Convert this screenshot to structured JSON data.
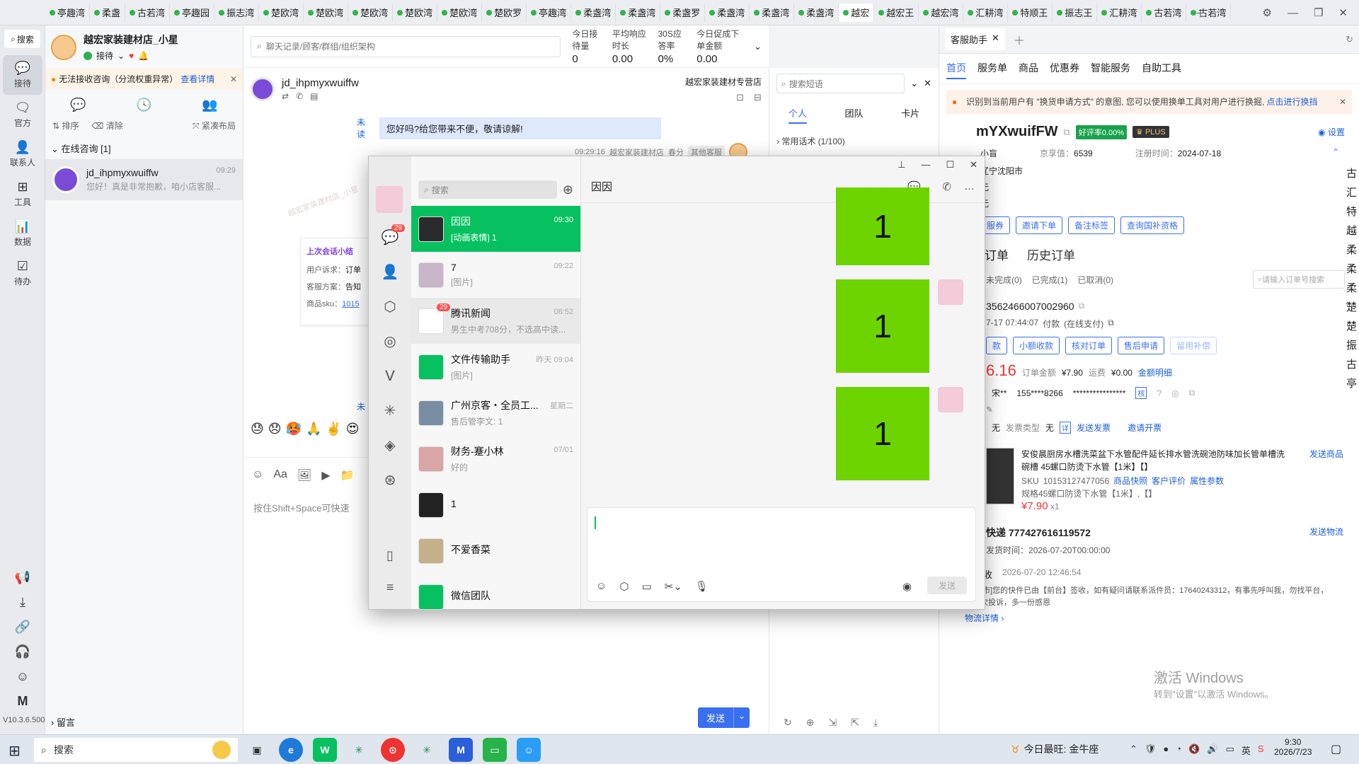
{
  "tabs": [
    "亭趣湾",
    "柔盏",
    "古若湾",
    "亭趣园",
    "振志湾",
    "楚欧湾",
    "楚欧湾",
    "楚欧湾",
    "楚欧湾",
    "楚欧湾",
    "楚欧罗",
    "亭趣湾",
    "柔盏湾",
    "柔盏湾",
    "柔盏罗",
    "柔盏湾",
    "柔盏湾",
    "柔盏湾",
    "越宏",
    "越宏王",
    "越宏湾",
    "汇耕湾",
    "特顺王",
    "振志王",
    "汇耕湾",
    "古若湾",
    "古若湾"
  ],
  "active_tab": 18,
  "leftnav": {
    "search": "搜索",
    "items": [
      {
        "label": "接待",
        "icon": "chat-icon"
      },
      {
        "label": "官方",
        "icon": "message-icon"
      },
      {
        "label": "联系人",
        "icon": "user-icon"
      },
      {
        "label": "工具",
        "icon": "grid-icon"
      },
      {
        "label": "数据",
        "icon": "chart-icon"
      },
      {
        "label": "待办",
        "icon": "todo-icon"
      }
    ],
    "version": "V10.3.6.500"
  },
  "sessions": {
    "shop_name": "越宏家装建材店_小星",
    "status": "接待",
    "warning": "无法接收咨询（分流权重异常）",
    "warning_link": "查看详情",
    "sort": "排序",
    "clear": "清除",
    "layout": "紧凑布局",
    "group": "在线咨询 [1]",
    "item": {
      "name": "jd_ihpmyxwuiffw",
      "time": "09:29",
      "preview": "您好！真是非常抱歉，咱小店客服..."
    },
    "leave_msg": "留言"
  },
  "chat": {
    "search_placeholder": "聊天记录/顾客/群组/组织架构",
    "stats": [
      {
        "label": "今日接待量",
        "value": "0"
      },
      {
        "label": "平均响应时长",
        "value": "0.00"
      },
      {
        "label": "30S应答率",
        "value": "0%"
      },
      {
        "label": "今日促成下单金额",
        "value": "0.00"
      }
    ],
    "customer": "jd_ihpmyxwuiffw",
    "store": "越宏家装建材专营店",
    "unread": "未读",
    "bubble": "您好吗?给您带来不便，敬请谅解!",
    "meta_time": "09:29:16",
    "meta_sender": "越宏家装建材店_春分",
    "meta_tag": "其他客服",
    "last_session_title": "上次会话小结",
    "last_fields": [
      {
        "k": "用户诉求：",
        "v": "订单"
      },
      {
        "k": "客服方案：",
        "v": "告知"
      },
      {
        "k": "商品sku：",
        "v": "1015"
      }
    ],
    "unread2": "未",
    "input_placeholder": "按住Shift+Space可快速",
    "send": "发送",
    "watermark": "越宏家装建材店_小星"
  },
  "quick": {
    "search_placeholder": "搜索短语",
    "tabs": [
      "个人",
      "团队",
      "卡片"
    ],
    "group": "常用话术 (1/100)"
  },
  "right": {
    "tab_title": "客服助手",
    "nav": [
      "首页",
      "服务单",
      "商品",
      "优惠券",
      "智能服务",
      "自助工具"
    ],
    "notice": "识别到当前用户有 \"换货申请方式\" 的意图, 您可以使用换单工具对用户进行换掘,",
    "notice_link": "点击进行换挡",
    "user": "mYXwuifFW",
    "good_rate": "好评率0.00%",
    "plus": "PLUS",
    "settings": "设置",
    "level": "小盲",
    "jingxiang_label": "京享值：",
    "jingxiang": "6539",
    "reg_label": "注册时间：",
    "reg": "2024-07-18",
    "location": "辽宁沈阳市",
    "line_a": "无",
    "line_b": "无",
    "actions": [
      "服券",
      "邀请下单",
      "备注标签",
      "查询国补资格"
    ],
    "order_tabs": [
      "订单",
      "历史订单"
    ],
    "order_filters": [
      "未完成(0)",
      "已完成(1)",
      "已取消(0)"
    ],
    "order_search": "请输入订单号搜索",
    "order_no": "3562466007002960",
    "order_time": "7-17 07:44:07",
    "pay": "付款",
    "pay_type": "(在线支付)",
    "order_btns": [
      "款",
      "小额收款",
      "核对订单",
      "售后申请",
      "留用补偿"
    ],
    "price_big": "6.16",
    "order_amount_label": "订单金额",
    "order_amount": "¥7.90",
    "freight_label": "运费",
    "freight": "¥0.00",
    "amount_detail": "金额明细",
    "buyer": "宋**",
    "phone": "155****8266",
    "masked": "****************",
    "verify": "核",
    "invoice_a": "无",
    "invoice_type_label": "发票类型",
    "invoice_type": "无",
    "detail": "详",
    "send_invoice": "发送发票",
    "invite_invoice": "邀请开票",
    "product_title": "安俊晨厨房水槽洗菜盆下水管配件延长排水管洗碗池防味加长管单槽洗碗槽 45螺口防烫下水管【1米】【】",
    "send_product": "发送商品",
    "sku_label": "SKU",
    "sku": "10153127477056",
    "product_links": [
      "商品快照",
      "客户评价",
      "属性参数"
    ],
    "spec": "规格45螺口防烫下水管【1米】,【】",
    "price": "¥7.90",
    "qty": "x1",
    "express": "快递 777427616119572",
    "send_logistics": "发送物流",
    "delivery_label": "发货时间：",
    "delivery": "2026-07-20T00:00:00",
    "signed": "已签收",
    "signed_time": "2026-07-20 12:46:54",
    "logistics_text": "[沈阳市]您的快件已由【前台】签收，如有疑问请联系派件员：17640243312，有事先呼叫我，勿找平台，少一次投诉，多一份感恩",
    "logistics_detail": "物流详情",
    "side_chars": [
      "古",
      "汇",
      "特",
      "越",
      "柔",
      "柔",
      "柔",
      "楚",
      "楚",
      "振",
      "古",
      "亭"
    ]
  },
  "activate": {
    "title": "激活 Windows",
    "sub": "转到\"设置\"以激活 Windows。"
  },
  "wechat": {
    "search": "搜索",
    "badge": "29",
    "chat_title": "因因",
    "send": "发送",
    "tile_text": "1",
    "list": [
      {
        "name": "因因",
        "preview": "[动画表情] 1",
        "time": "09:30",
        "color": "#2b2b2b"
      },
      {
        "name": "7",
        "preview": "[图片]",
        "time": "09:22",
        "color": "#c9b6c9"
      },
      {
        "name": "腾讯新闻",
        "preview": "男生中考708分，不选高中读...",
        "time": "06:52",
        "color": "#ffffff",
        "badge": "29"
      },
      {
        "name": "文件传输助手",
        "preview": "[图片]",
        "time": "昨天 09:04",
        "color": "#07c160"
      },
      {
        "name": "广州京客・全员工...",
        "preview": "售后管李文: 1",
        "time": "星期二",
        "color": "#7a8ea3"
      },
      {
        "name": "财务-蹇小林",
        "preview": "好的",
        "time": "07/01",
        "color": "#d9a5a5"
      },
      {
        "name": "1",
        "preview": "",
        "time": "",
        "color": "#222"
      },
      {
        "name": "不爱香菜",
        "preview": "",
        "time": "",
        "color": "#c4b08a"
      },
      {
        "name": "微信团队",
        "preview": "",
        "time": "",
        "color": "#07c160"
      }
    ]
  },
  "taskbar": {
    "search": "搜索",
    "news": "今日最旺: 金牛座",
    "ime": "英",
    "time": "9:30",
    "date": "2026/7/23"
  }
}
